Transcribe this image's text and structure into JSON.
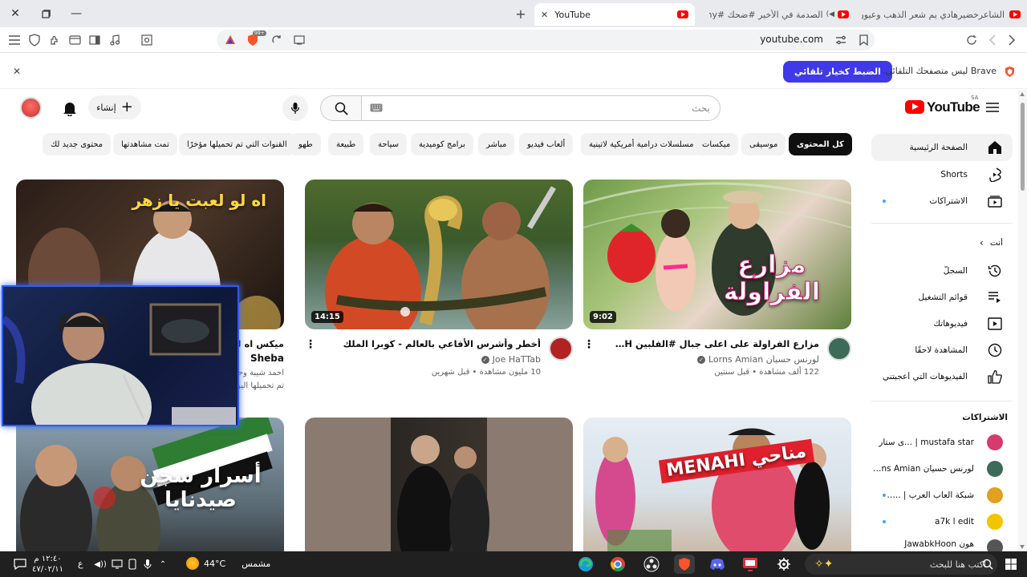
{
  "tabs": [
    {
      "label": "YouTube",
      "active": true
    },
    {
      "label": "الصدمة في الأخير #ضحك #funny",
      "active": false
    },
    {
      "label": "الشاعرخضيرهادي يم شعر الذهب وعيون",
      "active": false
    }
  ],
  "toolbar": {
    "url": "youtube.com",
    "shield_badge": "99+"
  },
  "banner": {
    "text": "Brave ليس متصفحك التلقائي.",
    "button": "الضبط كخيار تلقائي"
  },
  "header": {
    "logo": "YouTube",
    "country": "SA",
    "search_placeholder": "بحث",
    "create_label": "إنشاء"
  },
  "chips": [
    "كل المحتوى",
    "موسيقى",
    "ميكسات",
    "مسلسلات درامية أمريكية لاتينية",
    "ألعاب فيديو",
    "مباشر",
    "برامج كوميدية",
    "سياحة",
    "طبيعة",
    "طهو",
    "القنوات التي تم تحميلها مؤخرًا",
    "تمت مشاهدتها",
    "محتوى جديد لك"
  ],
  "sidebar": {
    "main": [
      {
        "label": "الصفحة الرئيسية",
        "icon": "home-icon"
      },
      {
        "label": "Shorts",
        "icon": "shorts-icon"
      },
      {
        "label": "الاشتراكات",
        "icon": "subscriptions-icon"
      }
    ],
    "you_label": "أنت",
    "you": [
      {
        "label": "السجلّ",
        "icon": "history-icon"
      },
      {
        "label": "قوائم التشغيل",
        "icon": "playlist-icon"
      },
      {
        "label": "فيديوهاتك",
        "icon": "your-videos-icon"
      },
      {
        "label": "المشاهدة لاحقًا",
        "icon": "watch-later-icon"
      },
      {
        "label": "الفيديوهات التي أعجبتني",
        "icon": "like-icon"
      }
    ],
    "subs_label": "الاشتراكات",
    "subs": [
      {
        "label": "mustafa star | ...ى ستار",
        "color": "#d63b6e"
      },
      {
        "label": "لورنس حسيان Lorns Amian...",
        "color": "#3d6b5a"
      },
      {
        "label": "شبكة العاب العرب | ...rk",
        "color": "#e0a020"
      },
      {
        "label": "a7k l edit",
        "color": "#f3c400"
      },
      {
        "label": "هون JawabkHoon",
        "color": "#555555"
      }
    ]
  },
  "videos": [
    {
      "title": "مزارع الفراولة على اعلى جبال #الفلبين PH في مدينة باكيو 😍",
      "channel": "لورنس حسيان Lorns Amian",
      "stats": "122 ألف مشاهدة • قبل سنتين",
      "duration": "9:02",
      "thumb_text": "مزارع الفراولة",
      "avatar_color": "#3d6b5a"
    },
    {
      "title": "أخطر وأشرس الأفاعي بالعالم - كوبرا الملك",
      "channel": "Joe HaTTab",
      "stats": "10 مليون مشاهدة • قبل شهرين",
      "duration": "14:15",
      "thumb_text": "",
      "avatar_color": "#b22222"
    },
    {
      "title": "ميكس اه لو لعبت يا زهر",
      "channel": "احمد شيبة وحمو",
      "channel_extra": "Sheba",
      "stats": "تم تحميلها اليوم",
      "duration": "",
      "thumb_text": "اه لو لعبت يا زهر",
      "avatar_color": "#444444"
    },
    {
      "title": "",
      "channel": "",
      "stats": "",
      "duration": "",
      "thumb_text": "مناحي MENAHI",
      "avatar_color": "#cc0000"
    },
    {
      "title": "",
      "channel": "",
      "stats": "",
      "duration": "",
      "thumb_text": "",
      "avatar_color": "#333333"
    },
    {
      "title": "",
      "channel": "",
      "stats": "",
      "duration": "",
      "thumb_text": "أسرار سجن صيدنايا",
      "avatar_color": "#333333"
    }
  ],
  "taskbar": {
    "search_placeholder": "اكتب هنا للبحث",
    "weather_temp": "44°C",
    "weather_desc": "مشمس",
    "time": "١٢:٤٠ م",
    "date": "٤٧/٠٢/١١",
    "lang": "ع"
  },
  "colors": {
    "accent": "#ff0000",
    "brave_button": "#3f39e8",
    "chip_active": "#0f0f0f"
  }
}
